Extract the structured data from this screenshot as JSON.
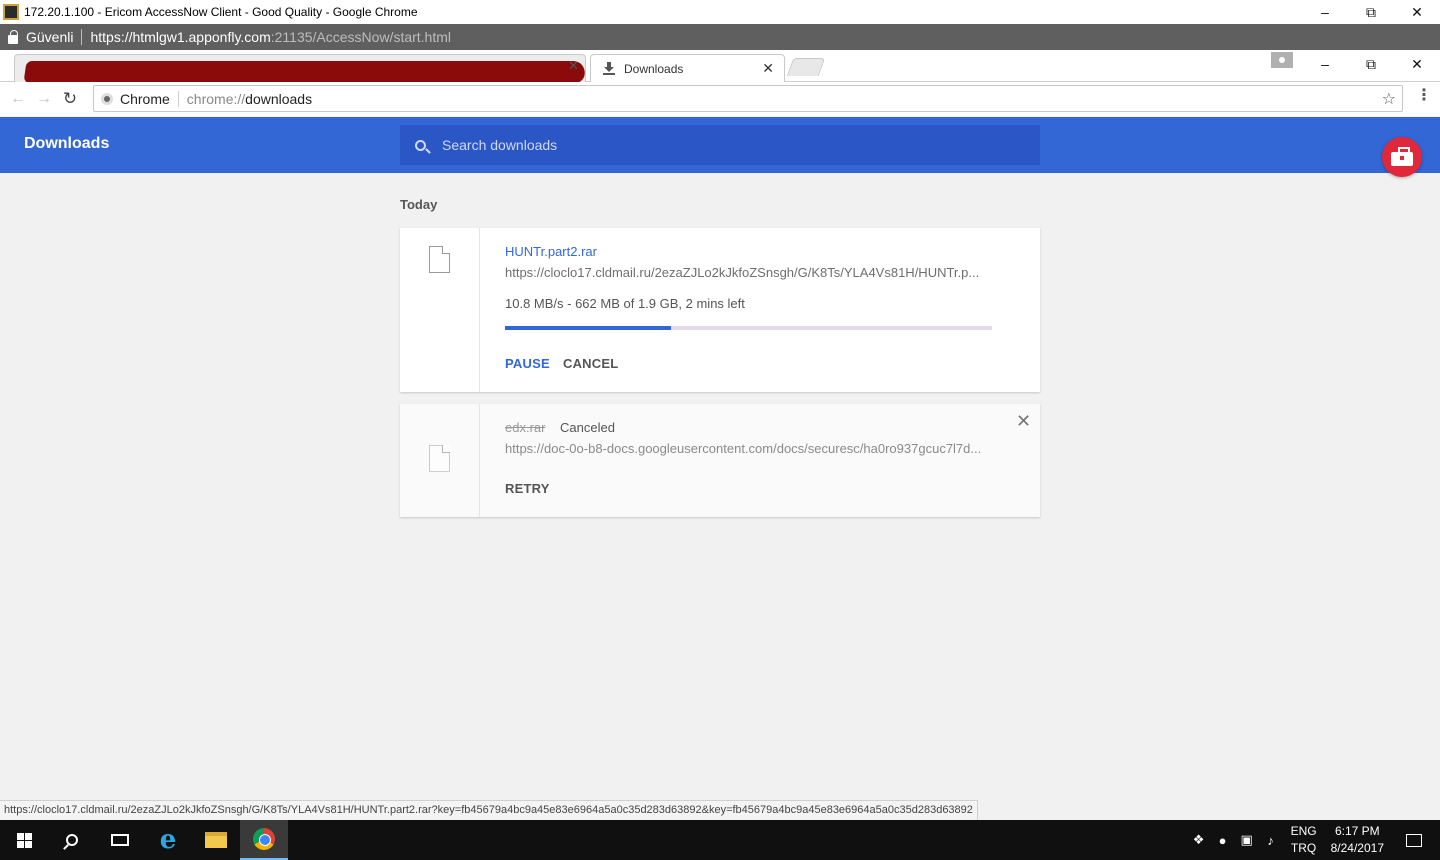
{
  "outer_window": {
    "title": "172.20.1.100 - Ericom AccessNow Client - Good Quality - Google Chrome",
    "secure_label": "Güvenli",
    "url_host": "https://htmlgw1.apponfly.com",
    "url_rest": ":21135/AccessNow/start.html"
  },
  "tabs": {
    "active_title": "Downloads"
  },
  "omnibox": {
    "site_label": "Chrome",
    "scheme": "chrome://",
    "host": "downloads"
  },
  "downloads_page": {
    "title": "Downloads",
    "search_placeholder": "Search downloads",
    "section_label": "Today",
    "items": [
      {
        "filename": "HUNTr.part2.rar",
        "url": "https://cloclo17.cldmail.ru/2ezaZJLo2kJkfoZSnsgh/G/K8Ts/YLA4Vs81H/HUNTr.p...",
        "status": "10.8 MB/s - 662 MB of 1.9 GB, 2 mins left",
        "progress_fraction": 0.34,
        "actions": [
          "PAUSE",
          "CANCEL"
        ]
      },
      {
        "filename": "edx.rar",
        "state": "Canceled",
        "url": "https://doc-0o-b8-docs.googleusercontent.com/docs/securesc/ha0ro937gcuc7l7d...",
        "actions": [
          "RETRY"
        ]
      }
    ]
  },
  "status_bubble": "https://cloclo17.cldmail.ru/2ezaZJLo2kJkfoZSnsgh/G/K8Ts/YLA4Vs81H/HUNTr.part2.rar?key=fb45679a4bc9a45e83e6964a5a0c35d283d63892&key=fb45679a4bc9a45e83e6964a5a0c35d283d63892",
  "taskbar": {
    "language_top": "ENG",
    "language_bottom": "TRQ",
    "time": "6:17 PM",
    "date": "8/24/2017"
  },
  "colors": {
    "header_blue": "#3367d6",
    "search_blue": "#2a56c6",
    "accent_red": "#e0283a",
    "progress_track": "#e4dbe8"
  }
}
